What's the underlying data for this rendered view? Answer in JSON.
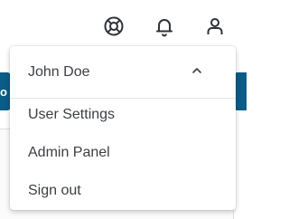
{
  "colors": {
    "accent": "#0b5c86",
    "icon": "#2f3237",
    "text": "#3c3f43"
  },
  "header": {
    "icons": [
      "lifebuoy-icon",
      "bell-icon",
      "user-icon"
    ]
  },
  "background": {
    "left_button_glyph": "o"
  },
  "user_menu": {
    "user_name": "John Doe",
    "expanded": true,
    "toggle_icon": "chevron-up-icon",
    "items": [
      {
        "label": "User Settings"
      },
      {
        "label": "Admin Panel"
      },
      {
        "label": "Sign out"
      }
    ]
  }
}
